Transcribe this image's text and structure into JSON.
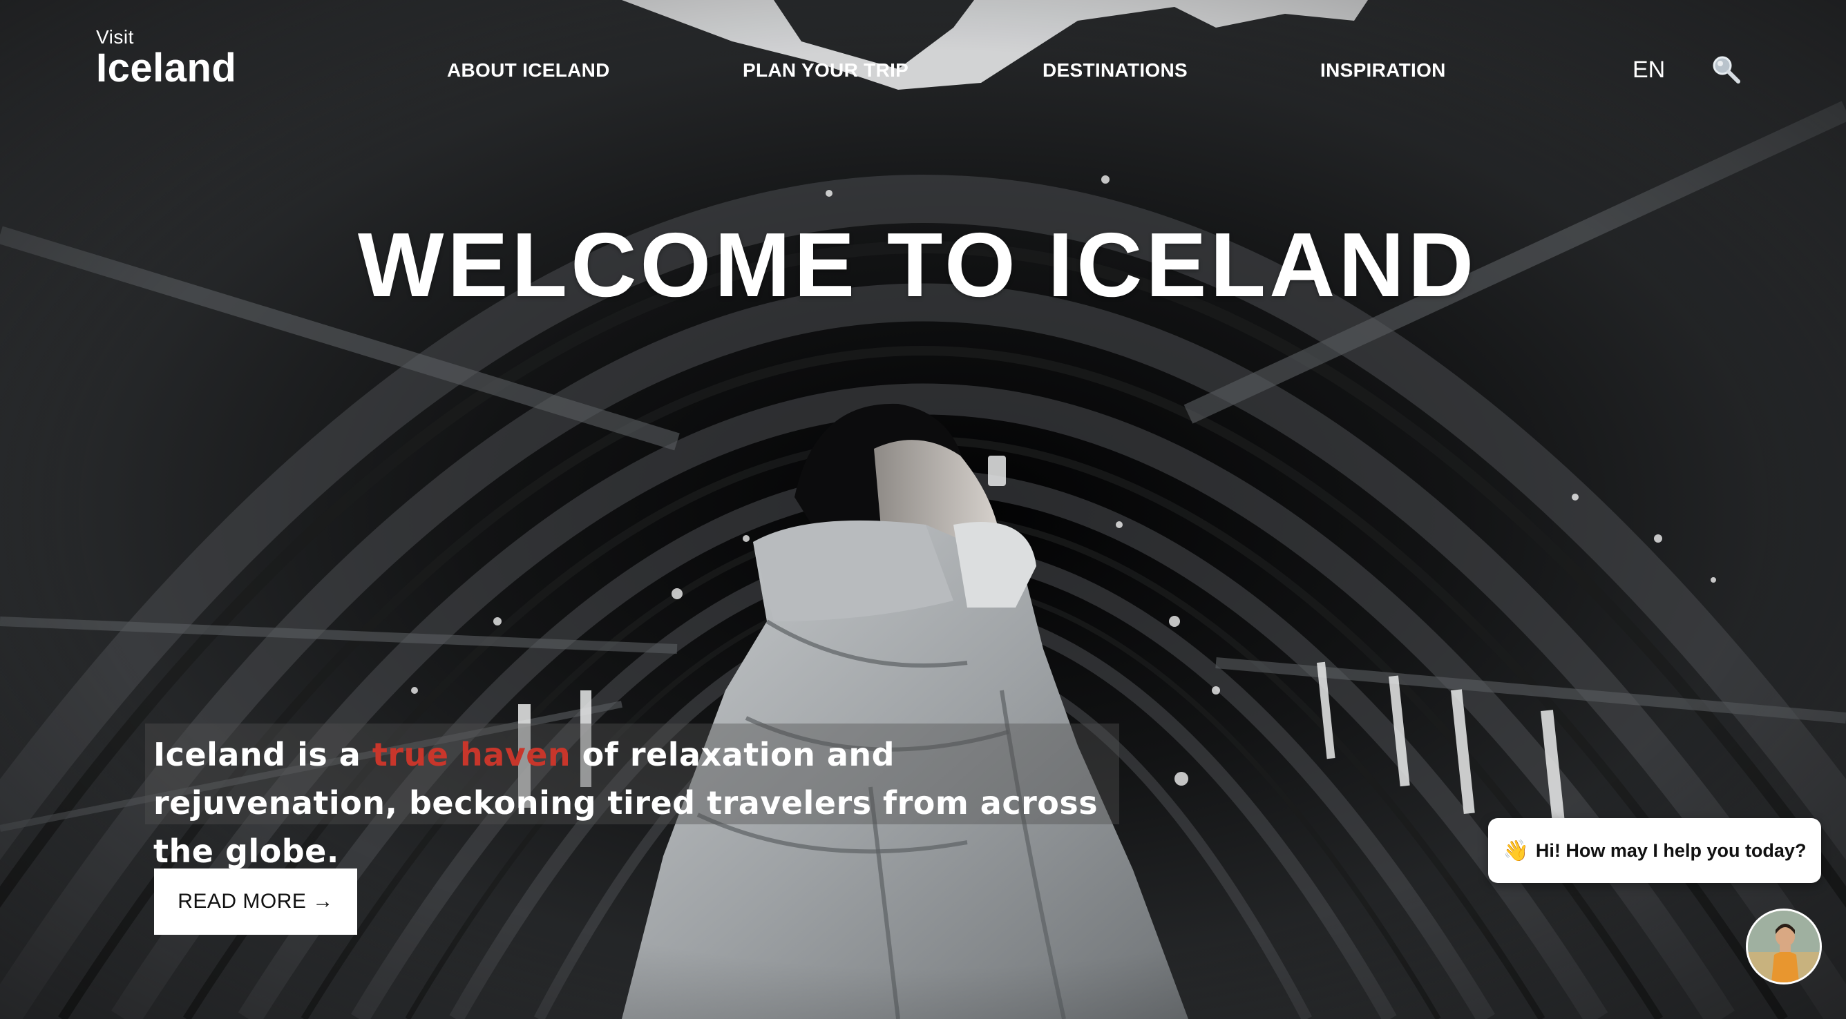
{
  "logo": {
    "small": "Visit",
    "big": "Iceland"
  },
  "nav": {
    "items": [
      {
        "label": "ABOUT ICELAND"
      },
      {
        "label": "PLAN YOUR TRIP"
      },
      {
        "label": "DESTINATIONS"
      },
      {
        "label": "INSPIRATION"
      }
    ],
    "language": "EN"
  },
  "hero": {
    "title": "WELCOME TO ICELAND",
    "tagline_before": "Iceland is a ",
    "tagline_highlight": "true haven",
    "tagline_after": " of relaxation and rejuvenation, beckoning tired travelers from across the globe.",
    "read_more": "READ MORE →"
  },
  "chat": {
    "wave": "👋",
    "message": "Hi! How may I help you today?"
  },
  "colors": {
    "accent": "#c8362b",
    "text": "#ffffff",
    "button_bg": "#ffffff"
  },
  "icons": {
    "search": "search-icon",
    "avatar": "assistant-avatar"
  }
}
